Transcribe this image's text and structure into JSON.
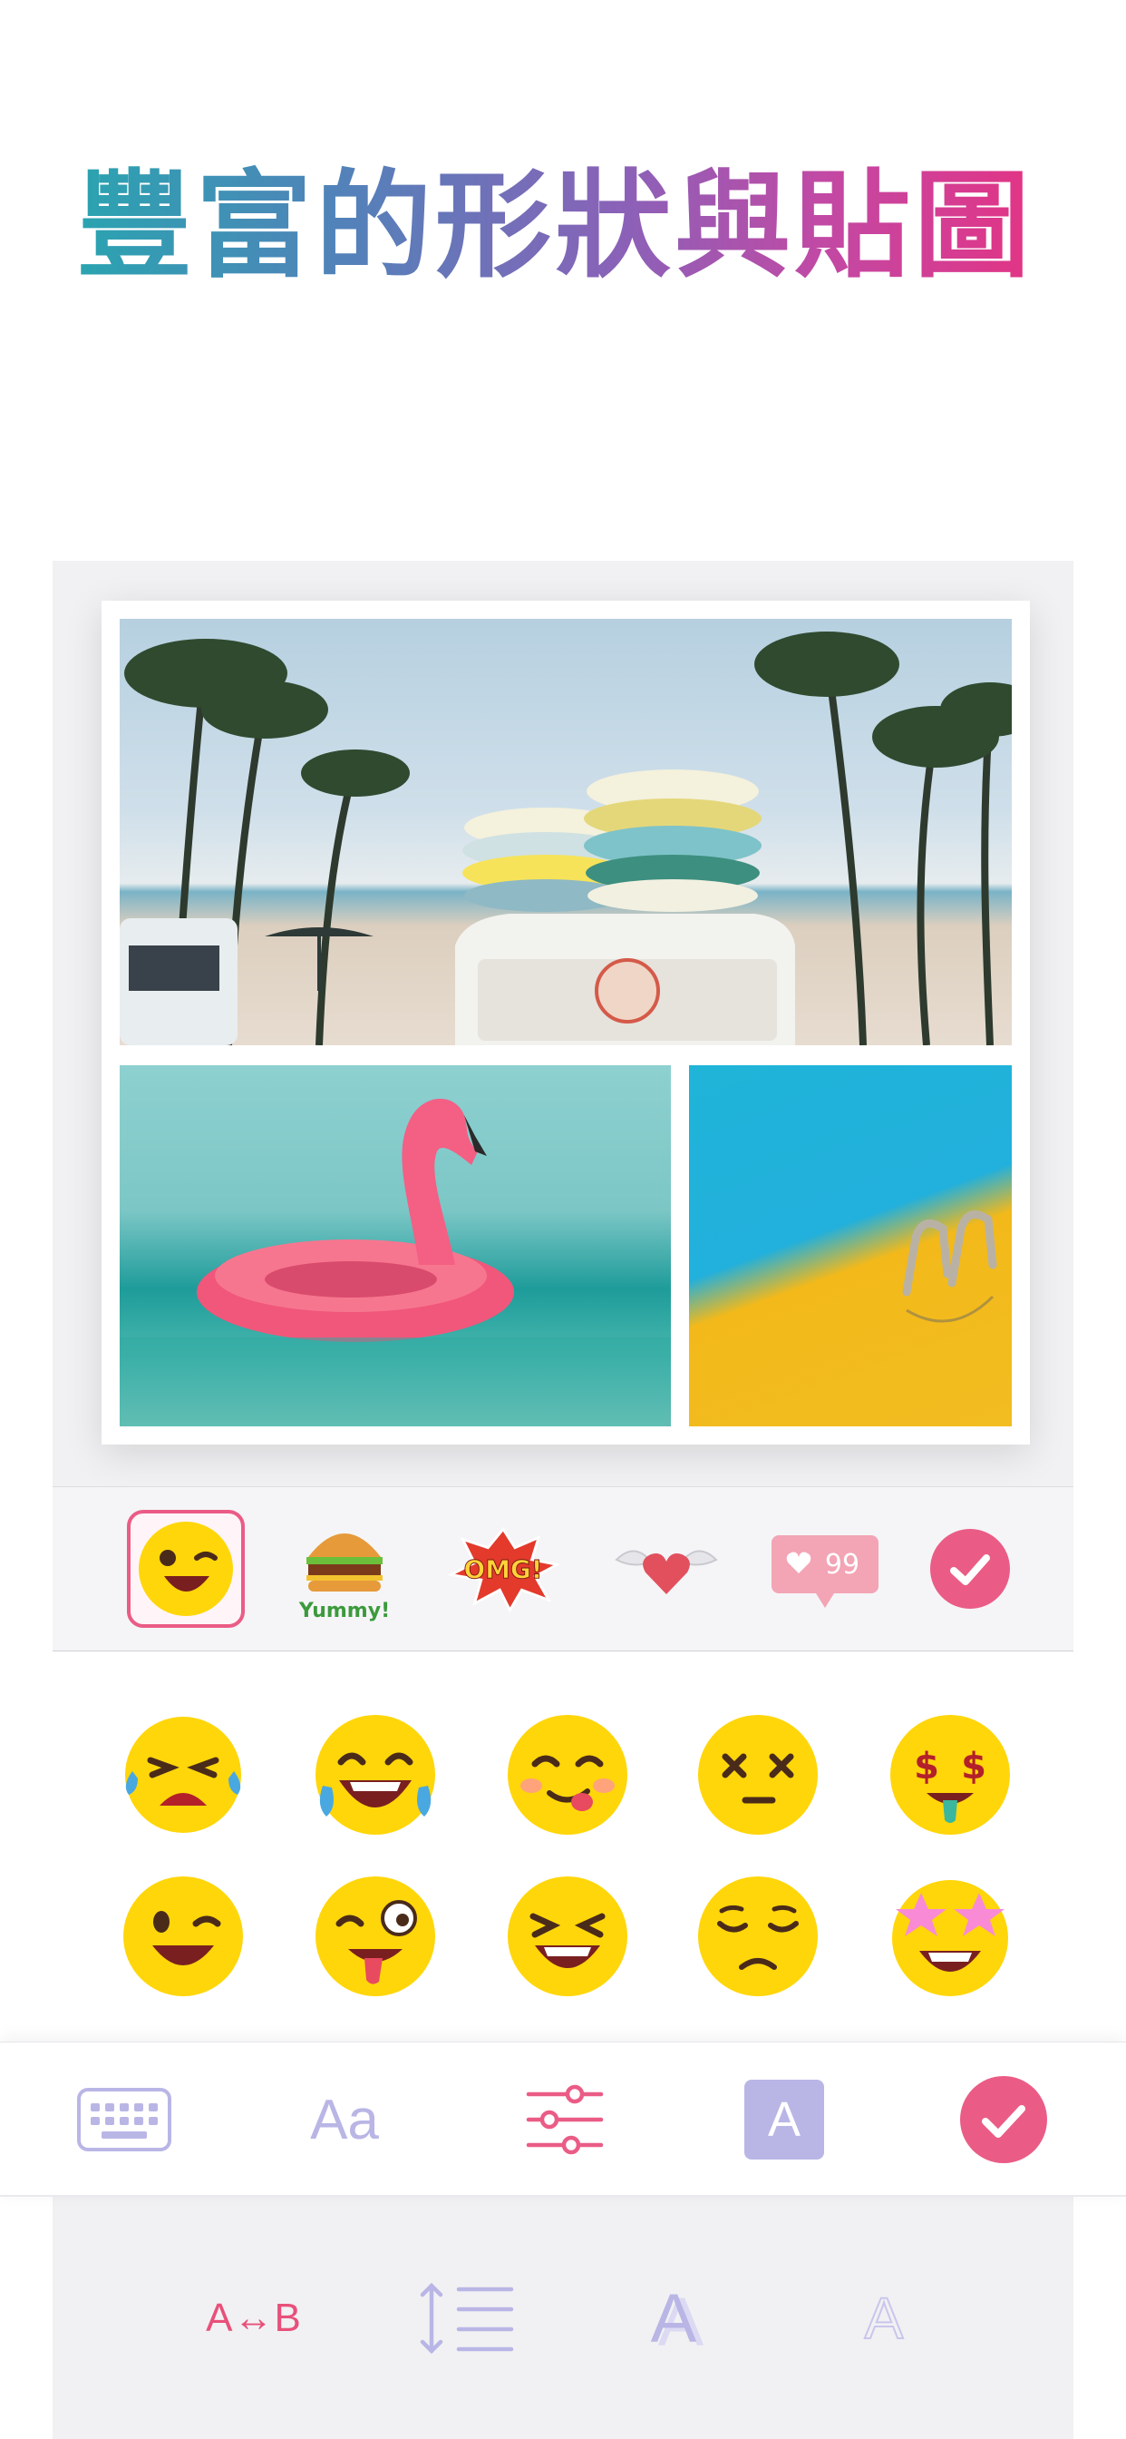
{
  "headline": "豐富的形狀與貼圖",
  "photos": {
    "beach": "beach-van-surfboards-photo",
    "flamingo": "flamingo-float-photo",
    "pool": "pool-ladder-photo"
  },
  "sticker_categories": [
    {
      "name": "emoji-category"
    },
    {
      "name": "food-category",
      "label": "Yummy!"
    },
    {
      "name": "comic-category",
      "label": "OMG!"
    },
    {
      "name": "love-category"
    },
    {
      "name": "social-category",
      "label": "99"
    }
  ],
  "emojis": [
    "crying-laughing-emoji",
    "tears-of-joy-emoji",
    "yum-emoji",
    "dizzy-face-emoji",
    "money-mouth-emoji",
    "wink-emoji",
    "zany-face-emoji",
    "grinning-squint-emoji",
    "pensive-emoji",
    "star-struck-emoji"
  ],
  "toolbar": {
    "font_label": "Aa",
    "background_label": "A"
  },
  "sub_tools": {
    "swap_label": "A↔B",
    "fill_label": "A",
    "outline_label": "A"
  },
  "colors": {
    "accent": "#ea5c86",
    "lavender": "#b9b6e6",
    "emoji_yellow": "#ffd60a"
  }
}
